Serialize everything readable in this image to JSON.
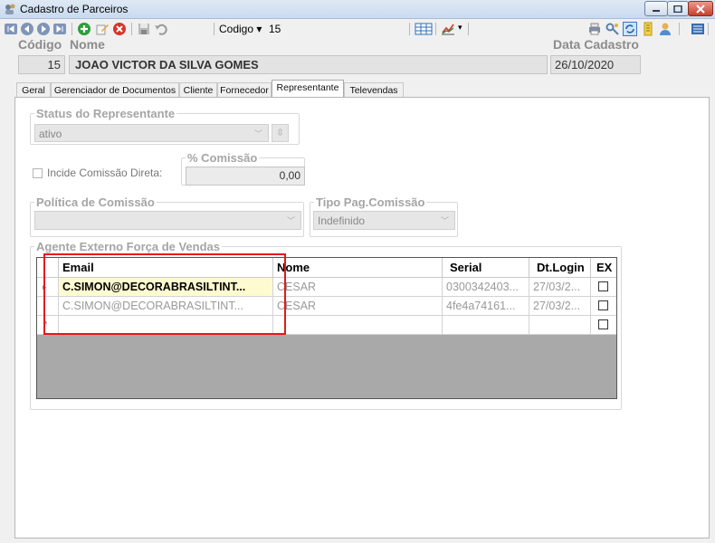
{
  "window": {
    "title": "Cadastro de Parceiros"
  },
  "toolbar": {
    "codigo_label": "Codigo ▾",
    "codigo_value": "15"
  },
  "header": {
    "codigo_label": "Código",
    "nome_label": "Nome",
    "data_label": "Data Cadastro",
    "codigo_value": "15",
    "nome_value": "JOAO VICTOR DA SILVA GOMES",
    "data_value": "26/10/2020"
  },
  "tabs": [
    {
      "label": "Geral"
    },
    {
      "label": "Gerenciador de Documentos"
    },
    {
      "label": "Cliente"
    },
    {
      "label": "Fornecedor"
    },
    {
      "label": "Representante"
    },
    {
      "label": "Televendas"
    }
  ],
  "rep": {
    "status_legend": "Status do Representante",
    "status_value": "ativo",
    "incide_label": "Incide Comissão Direta:",
    "comissao_legend": "% Comissão",
    "comissao_value": "0,00",
    "politica_legend": "Política de Comissão",
    "politica_value": "",
    "tipo_legend": "Tipo Pag.Comissão",
    "tipo_value": "Indefinido",
    "agente_legend": "Agente Externo Força de Vendas"
  },
  "grid": {
    "headers": {
      "email": "Email",
      "nome": "Nome",
      "serial": "Serial",
      "dtlogin": "Dt.Login",
      "ex": "EX"
    },
    "rows": [
      {
        "email": "C.SIMON@DECORABRASILTINT...",
        "nome": "CESAR",
        "serial": "0300342403...",
        "dtlogin": "27/03/2..."
      },
      {
        "email": "C.SIMON@DECORABRASILTINT...",
        "nome": "CESAR",
        "serial": "4fe4a74161...",
        "dtlogin": "27/03/2..."
      }
    ]
  },
  "colors": {
    "highlight": "#e8161b",
    "selected_cell": "#fffbd0"
  }
}
